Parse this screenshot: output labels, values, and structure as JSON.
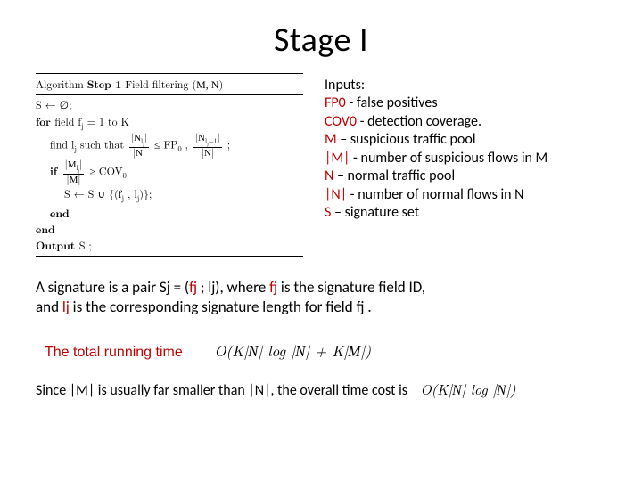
{
  "title": "Stage I",
  "algo": {
    "header_prefix": "Algorithm ",
    "header_bold": "Step 1",
    "header_suffix": " Field filtering (",
    "header_mn": "M, N",
    "header_close": ")",
    "l1a": "S ← ∅;",
    "l2a": "for ",
    "l2b": "field f",
    "l2c": "j",
    "l2d": " = 1 to K",
    "l3a": "find l",
    "l3b": "j",
    "l3c": " such that ",
    "frac1_num_a": "|",
    "frac1_num_b": "N",
    "frac1_num_c": "l",
    "frac1_num_d": "j",
    "frac1_num_e": "|",
    "frac1_den_a": "|",
    "frac1_den_b": "N",
    "frac1_den_c": "|",
    "l3d": " ≤ FP",
    "l3e": "0",
    "l3f": " , ",
    "frac2_num_a": "|",
    "frac2_num_b": "N",
    "frac2_num_c": "l",
    "frac2_num_d": "j",
    "frac2_num_e": "−1",
    "frac2_num_f": "|",
    "frac2_den_a": "|",
    "frac2_den_b": "N",
    "frac2_den_c": "|",
    "l3g": " ;",
    "l4a": "if ",
    "frac3_num_a": "|",
    "frac3_num_b": "M",
    "frac3_num_c": "l",
    "frac3_num_d": "j",
    "frac3_num_e": "|",
    "frac3_den_a": "|",
    "frac3_den_b": "M",
    "frac3_den_c": "|",
    "l4b": " ≥ COV",
    "l4c": "0",
    "l5a": "S ← S ∪ {(f",
    "l5b": "j",
    "l5c": " , l",
    "l5d": "j",
    "l5e": ")};",
    "l6": "end",
    "l7": "end",
    "l8a": "Output ",
    "l8b": "S ;"
  },
  "inputs": {
    "heading": "Inputs:",
    "fp_label": "FP0",
    "fp_desc": "  - false positives",
    "cov_label": "COV0",
    "cov_desc": " - detection coverage.",
    "m_label": "M",
    "m_desc": " – suspicious traffic pool",
    "mabs_label": "|M|",
    "mabs_desc": " - number of suspicious flows in M",
    "n_label": "N",
    "n_desc": " – normal traffic pool",
    "nabs_label": "|N|",
    "nabs_desc": " - number of normal flows in N",
    "s_label": "S",
    "s_desc": " – signature set"
  },
  "signature": {
    "a": "A signature is a pair Sj = (",
    "b": "fj",
    "c": " ; lj), where ",
    "d": "fj",
    "e": "  is the signature field ID,",
    "f": "and ",
    "g": "lj",
    "h": " is the corresponding signature length for field fj ."
  },
  "running": {
    "label": "The total running time",
    "bigO_a": "O(K|",
    "bigO_b": "N",
    "bigO_c": "| log |",
    "bigO_d": "N",
    "bigO_e": "| + K|",
    "bigO_f": "M",
    "bigO_g": "|)"
  },
  "timecost": {
    "a": "Since |M| is usually far smaller than |N|, the overall time cost is",
    "bigO_a": "O(K|",
    "bigO_b": "N",
    "bigO_c": "| log |",
    "bigO_d": "N",
    "bigO_e": "|)"
  }
}
